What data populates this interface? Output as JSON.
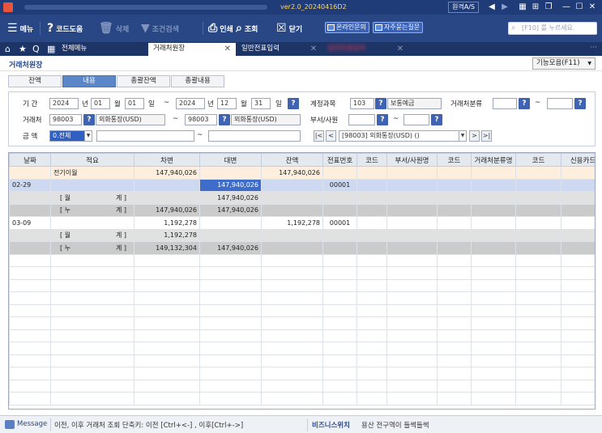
{
  "titlebar": {
    "version": "ver2.0_20240416D2",
    "remote": "원격A/S"
  },
  "toolbar": {
    "menu": "메뉴",
    "code_help": "코드도움",
    "delete": "삭제",
    "condition_search": "조건검색",
    "print": "인쇄",
    "inquiry": "조회",
    "close": "닫기",
    "online_inquiry": "온라인문의",
    "faq": "자주묻는질문",
    "search_placeholder": "[F10] 를 누르세요."
  },
  "tabs": {
    "all_menu": "전체메뉴",
    "ledger": "거래처원장",
    "journal": "일반전표입력",
    "hidden": "일반전표입력"
  },
  "screen": {
    "title": "거래처원장",
    "function_menu": "기능모음(F11)"
  },
  "subtabs": [
    "잔액",
    "내용",
    "총괄잔액",
    "총괄내용"
  ],
  "filter": {
    "period_label": "기    간",
    "from_year": "2024",
    "year_unit": "년",
    "from_month": "01",
    "month_unit": "월",
    "from_day": "01",
    "day_unit": "일",
    "tilde": "~",
    "to_year": "2024",
    "to_month": "12",
    "to_day": "31",
    "account_label": "계정과목",
    "account_code": "103",
    "account_name": "보통예금",
    "client_type_label": "거래처분류",
    "client_label": "거래처",
    "client_from_code": "98003",
    "client_from_name": "외화통장(USD)",
    "client_to_code": "98003",
    "client_to_name": "외화통장(USD)",
    "dept_label": "부서/사원",
    "amount_label": "금    액",
    "amount_value": "0.전체",
    "client_nav_value": "[98003] 외화통장(USD) ()"
  },
  "grid": {
    "columns": [
      "날짜",
      "적요",
      "차변",
      "대변",
      "잔액",
      "전표번호",
      "코드",
      "부서/사원명",
      "코드",
      "거래처분류명",
      "코드",
      "신용카드"
    ],
    "rows": [
      {
        "style": "orange",
        "date": "",
        "desc": "전기이월",
        "debit": "147,940,026",
        "credit": "",
        "balance": "147,940,026",
        "slip": ""
      },
      {
        "style": "blue",
        "date": "02-29",
        "desc": "",
        "debit": "",
        "credit": "147,940,026",
        "balance": "",
        "slip": "00001"
      },
      {
        "style": "gray",
        "date": "",
        "desc_l": "[ 월",
        "desc_r": "계 ]",
        "debit": "",
        "credit": "147,940,026",
        "balance": "",
        "slip": ""
      },
      {
        "style": "dgray",
        "date": "",
        "desc_l": "[ 누",
        "desc_r": "계 ]",
        "debit": "147,940,026",
        "credit": "147,940,026",
        "balance": "",
        "slip": ""
      },
      {
        "style": "white",
        "date": "03-09",
        "desc": "",
        "debit": "1,192,278",
        "credit": "",
        "balance": "1,192,278",
        "slip": "00001"
      },
      {
        "style": "gray",
        "date": "",
        "desc_l": "[ 월",
        "desc_r": "계 ]",
        "debit": "1,192,278",
        "credit": "",
        "balance": "",
        "slip": ""
      },
      {
        "style": "dgray",
        "date": "",
        "desc_l": "[ 누",
        "desc_r": "계 ]",
        "debit": "149,132,304",
        "credit": "147,940,026",
        "balance": "",
        "slip": ""
      }
    ]
  },
  "status": {
    "message_label": "Message",
    "shortcut_text": "이전, 이후 거래처 조회 단축키: 이전 [Ctrl+<-] , 이후[Ctrl+->]",
    "business_label": "비즈니스위치",
    "business_text": "용산 전구역이 들썩들썩"
  }
}
